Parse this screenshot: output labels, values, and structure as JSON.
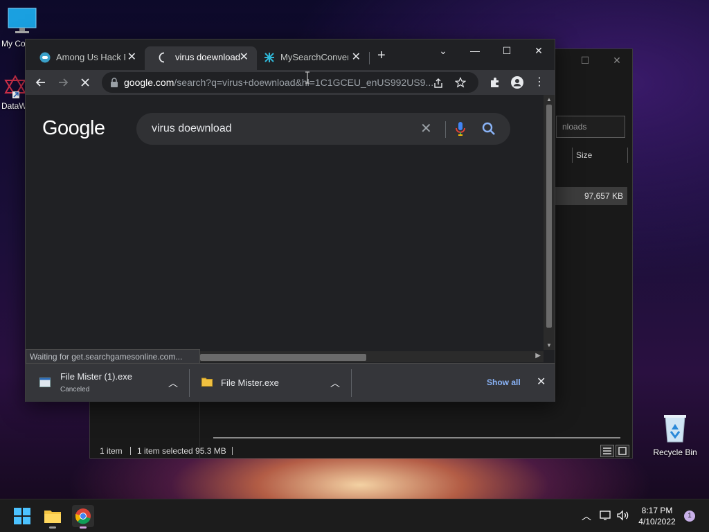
{
  "desktop": {
    "icons": [
      {
        "label": "My Co"
      },
      {
        "label": "DataW"
      },
      {
        "label": "Recycle Bin"
      }
    ]
  },
  "explorer": {
    "search_text": "nloads",
    "col_size": "Size",
    "row_size": "97,657 KB",
    "status_items": "1 item",
    "status_selected": "1 item selected  95.3 MB"
  },
  "chrome": {
    "tabs": [
      {
        "title": "Among Us Hack Pl",
        "close": "✕"
      },
      {
        "title": "virus doewnload -",
        "close": "✕"
      },
      {
        "title": "MySearchConverte",
        "close": "✕"
      }
    ],
    "new_tab": "+",
    "omnibox": {
      "host": "google.com",
      "path": "/search?q=virus+doewnload&hl=1C1GCEU_enUS992US9..."
    },
    "google": {
      "logo": "Google",
      "query": "virus doewnload"
    },
    "status_text": "Waiting for get.searchgamesonline.com...",
    "downloads": {
      "items": [
        {
          "name": "File Mister (1).exe",
          "status": "Canceled"
        },
        {
          "name": "File Mister.exe",
          "status": ""
        }
      ],
      "show_all": "Show all"
    }
  },
  "taskbar": {
    "time": "8:17 PM",
    "date": "4/10/2022",
    "notifications": "1"
  },
  "colors": {
    "accent_link": "#8ab4f8",
    "chrome_bg": "#202124",
    "toolbar_bg": "#35363a"
  }
}
